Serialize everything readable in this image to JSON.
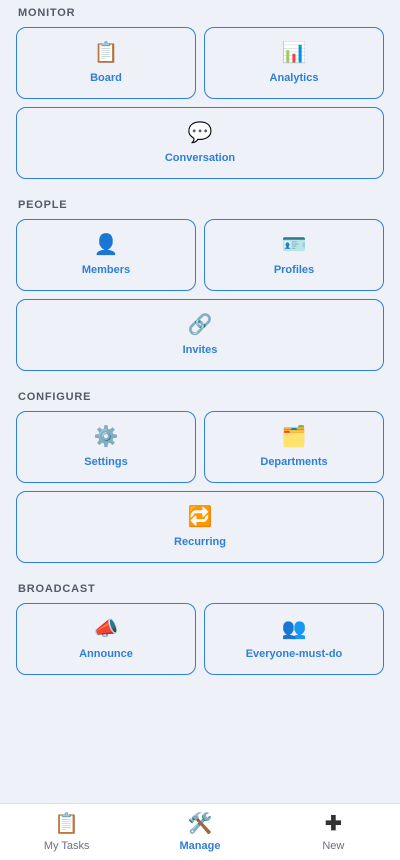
{
  "sections": [
    {
      "title": "MONITOR",
      "tiles": [
        {
          "label": "Board",
          "icon": "📋",
          "icon_name": "clipboard-icon"
        },
        {
          "label": "Analytics",
          "icon": "📊",
          "icon_name": "bar-chart-icon"
        },
        {
          "label": "Conversation",
          "icon": "💬",
          "icon_name": "speech-bubble-icon"
        }
      ]
    },
    {
      "title": "PEOPLE",
      "tiles": [
        {
          "label": "Members",
          "icon": "👤",
          "icon_name": "person-icon"
        },
        {
          "label": "Profiles",
          "icon": "🪪",
          "icon_name": "id-card-icon"
        },
        {
          "label": "Invites",
          "icon": "🔗",
          "icon_name": "link-icon"
        }
      ]
    },
    {
      "title": "CONFIGURE",
      "tiles": [
        {
          "label": "Settings",
          "icon": "⚙️",
          "icon_name": "gear-icon"
        },
        {
          "label": "Departments",
          "icon": "🗂️",
          "icon_name": "folders-icon"
        },
        {
          "label": "Recurring",
          "icon": "🔁",
          "icon_name": "repeat-icon"
        }
      ]
    },
    {
      "title": "BROADCAST",
      "tiles": [
        {
          "label": "Announce",
          "icon": "📣",
          "icon_name": "megaphone-icon"
        },
        {
          "label": "Everyone-must-do",
          "icon": "👥",
          "icon_name": "group-icon"
        }
      ]
    }
  ],
  "tabbar": [
    {
      "label": "My Tasks",
      "icon": "📋",
      "icon_name": "clipboard-icon",
      "active": false
    },
    {
      "label": "Manage",
      "icon": "🛠️",
      "icon_name": "tools-icon",
      "active": true
    },
    {
      "label": "New",
      "icon": "✚",
      "icon_name": "plus-icon",
      "active": false
    }
  ],
  "colors": {
    "accent": "#2f7fd6",
    "background": "#eef1f7"
  }
}
